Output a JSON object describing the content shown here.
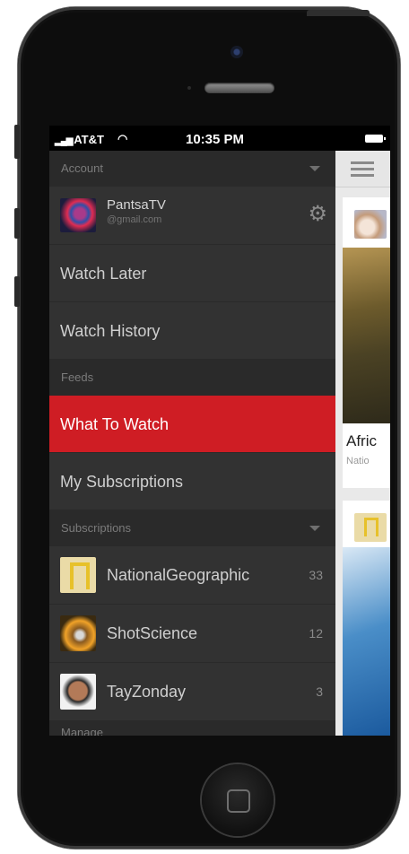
{
  "status_bar": {
    "carrier": "AT&T",
    "time": "10:35 PM"
  },
  "sidebar": {
    "account_header": "Account",
    "account": {
      "name": "PantsaTV",
      "email": "@gmail.com"
    },
    "items": [
      {
        "label": "Watch Later"
      },
      {
        "label": "Watch History"
      }
    ],
    "feeds_header": "Feeds",
    "feeds": [
      {
        "label": "What To Watch",
        "active": true
      },
      {
        "label": "My Subscriptions",
        "active": false
      }
    ],
    "subscriptions_header": "Subscriptions",
    "subscriptions": [
      {
        "name": "NationalGeographic",
        "count": "33"
      },
      {
        "name": "ShotScience",
        "count": "12"
      },
      {
        "name": "TayZonday",
        "count": "3"
      }
    ],
    "manage_header": "Manage"
  },
  "feed": {
    "card1": {
      "title": "Afric",
      "subtitle": "Natio"
    }
  },
  "colors": {
    "accent": "#cf1d24",
    "sidebar_bg": "#323232",
    "section_bg": "#2a2a2a"
  }
}
